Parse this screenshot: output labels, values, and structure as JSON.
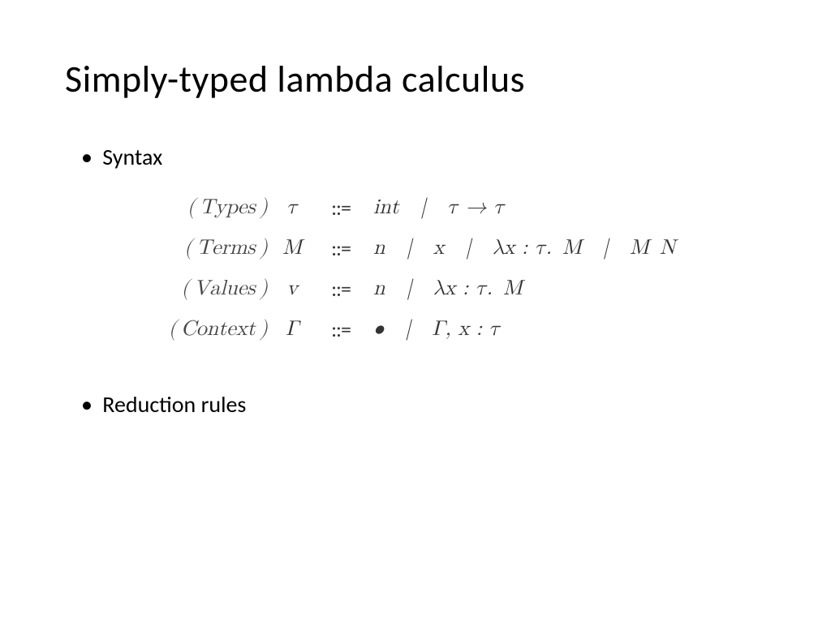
{
  "title": "Simply-typed lambda calculus",
  "bullets": {
    "syntax": "Syntax",
    "reduction": "Reduction rules"
  },
  "grammar": {
    "eq_symbol": "::=",
    "rows": [
      {
        "label": "( Types )",
        "symbol": "τ",
        "rhs": "int | τ → τ"
      },
      {
        "label": "( Terms )",
        "symbol": "M",
        "rhs": "n | x | λx : τ. M | M N"
      },
      {
        "label": "( Values )",
        "symbol": "v",
        "rhs": "n | λx : τ. M"
      },
      {
        "label": "( Context )",
        "symbol": "Γ",
        "rhs": "• | Γ, x : τ"
      }
    ]
  }
}
